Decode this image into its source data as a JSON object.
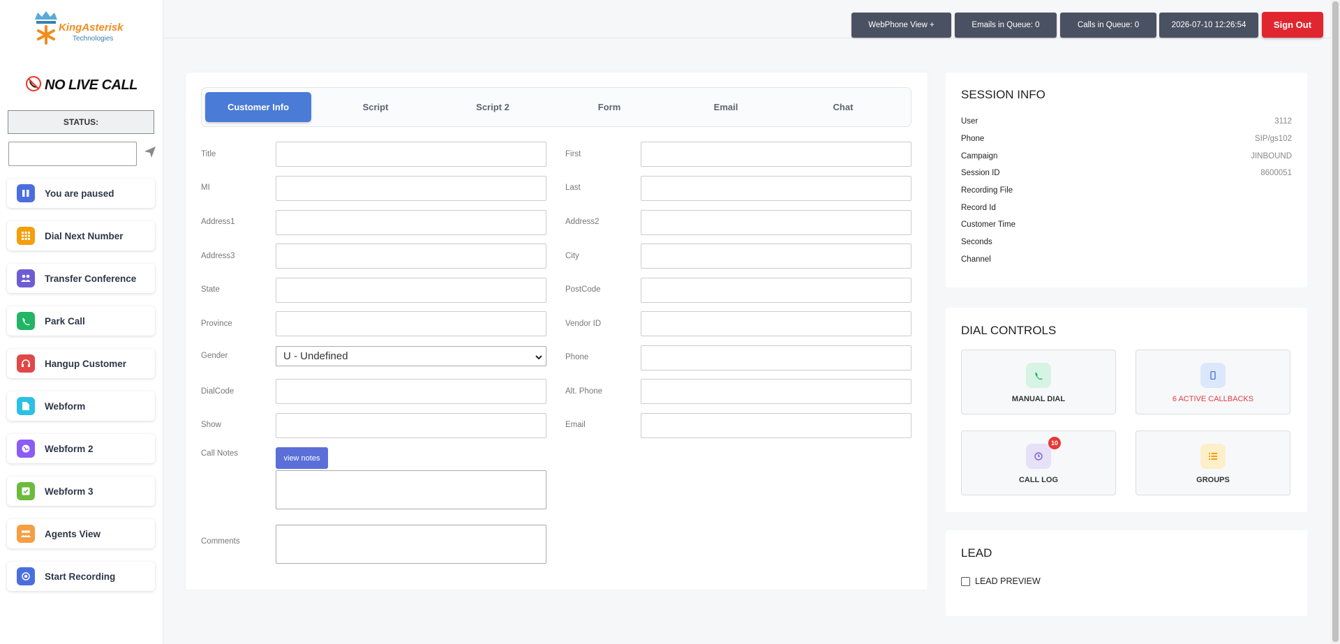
{
  "brand": {
    "name": "KingAsterisk",
    "sub": "Technologies"
  },
  "call_state": "NO LIVE CALL",
  "status": {
    "label": "STATUS:",
    "input_value": ""
  },
  "sidebar": {
    "items": [
      {
        "label": "You are paused",
        "color": "#4a6ee0",
        "icon": "pause-icon"
      },
      {
        "label": "Dial Next Number",
        "color": "#f59e0b",
        "icon": "keypad-icon"
      },
      {
        "label": "Transfer Conference",
        "color": "#6d5dd3",
        "icon": "users-icon"
      },
      {
        "label": "Park Call",
        "color": "#22b566",
        "icon": "phone-icon"
      },
      {
        "label": "Hangup Customer",
        "color": "#e14848",
        "icon": "headset-icon"
      },
      {
        "label": "Webform",
        "color": "#2bc0e4",
        "icon": "document-icon"
      },
      {
        "label": "Webform 2",
        "color": "#8b5cf6",
        "icon": "globe-icon"
      },
      {
        "label": "Webform 3",
        "color": "#6cbb3c",
        "icon": "checkbox-icon"
      },
      {
        "label": "Agents View",
        "color": "#f59e42",
        "icon": "agents-icon"
      },
      {
        "label": "Start Recording",
        "color": "#4a6ee0",
        "icon": "record-icon"
      }
    ]
  },
  "topbar": {
    "webphone": "WebPhone View +",
    "emails": "Emails in Queue: 0",
    "calls": "Calls in Queue: 0",
    "datetime": "2026-07-10 12:26:54",
    "signout": "Sign Out"
  },
  "tabs": [
    "Customer Info",
    "Script",
    "Script 2",
    "Form",
    "Email",
    "Chat"
  ],
  "form": {
    "left": [
      "Title",
      "MI",
      "Address1",
      "Address3",
      "State",
      "Province",
      "Gender",
      "DialCode",
      "Show",
      "Call Notes",
      "Comments"
    ],
    "right": [
      "First",
      "Last",
      "Address2",
      "City",
      "PostCode",
      "Vendor ID",
      "Phone",
      "Alt. Phone",
      "Email"
    ],
    "gender_value": "U - Undefined",
    "view_notes": "view notes"
  },
  "session": {
    "title": "SESSION INFO",
    "rows": [
      {
        "k": "User",
        "v": "3112"
      },
      {
        "k": "Phone",
        "v": "SIP/gs102"
      },
      {
        "k": "Campaign",
        "v": "JINBOUND"
      },
      {
        "k": "Session ID",
        "v": "8600051"
      },
      {
        "k": "Recording File",
        "v": ""
      },
      {
        "k": "Record Id",
        "v": ""
      },
      {
        "k": "Customer Time",
        "v": ""
      },
      {
        "k": "Seconds",
        "v": ""
      },
      {
        "k": "Channel",
        "v": ""
      }
    ]
  },
  "dial_controls": {
    "title": "DIAL CONTROLS",
    "tiles": [
      {
        "label": "MANUAL DIAL",
        "color": "#333"
      },
      {
        "label": "6 ACTIVE CALLBACKS",
        "color": "#e53945"
      },
      {
        "label": "CALL LOG",
        "badge": "10",
        "color": "#333"
      },
      {
        "label": "GROUPS",
        "color": "#333"
      }
    ]
  },
  "lead": {
    "title": "LEAD",
    "checkbox_label": "LEAD PREVIEW",
    "checked": false
  }
}
